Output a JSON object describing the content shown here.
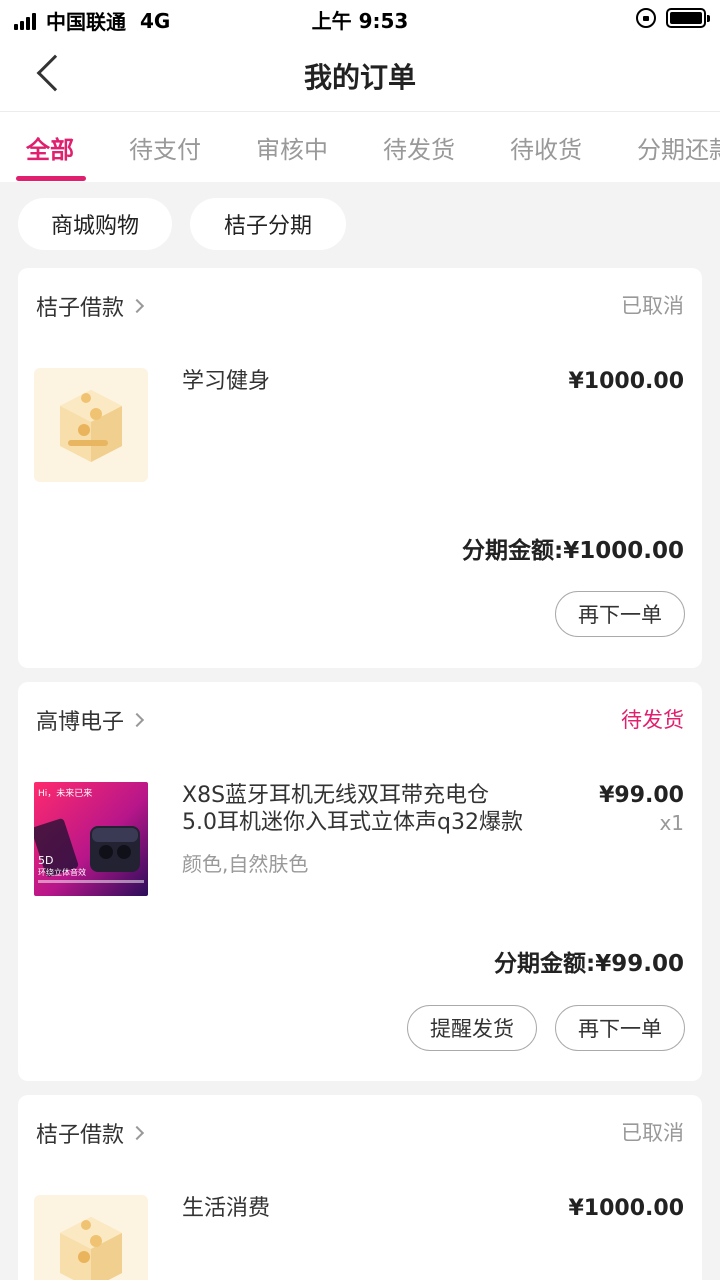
{
  "status_bar": {
    "carrier": "中国联通",
    "network": "4G",
    "time": "上午 9:53"
  },
  "nav": {
    "title": "我的订单"
  },
  "tabs": [
    {
      "label": "全部",
      "active": true
    },
    {
      "label": "待支付"
    },
    {
      "label": "审核中"
    },
    {
      "label": "待发货"
    },
    {
      "label": "待收货"
    },
    {
      "label": "分期还款"
    }
  ],
  "chips": [
    "商城购物",
    "桔子分期"
  ],
  "orders": [
    {
      "merchant": "桔子借款",
      "status": "已取消",
      "product_name": "学习健身",
      "price": "¥1000.00",
      "total": "分期金额:¥1000.00",
      "buttons": [
        "再下一单"
      ]
    },
    {
      "merchant": "高博电子",
      "status": "待发货",
      "product_name_line1": "X8S蓝牙耳机无线双耳带充电仓",
      "product_name_line2": "5.0耳机迷你入耳式立体声q32爆款",
      "spec": "颜色,自然肤色",
      "price": "¥99.00",
      "qty": "x1",
      "thumb_text": {
        "tagline": "Hi，未来已来",
        "badge": "5D",
        "subtitle": "环绕立体音效"
      },
      "total": "分期金额:¥99.00",
      "buttons": [
        "提醒发货",
        "再下一单"
      ]
    },
    {
      "merchant": "桔子借款",
      "status": "已取消",
      "product_name": "生活消费",
      "price": "¥1000.00"
    }
  ],
  "colors": {
    "accent": "#e0206e",
    "background": "#f3f3f3"
  }
}
